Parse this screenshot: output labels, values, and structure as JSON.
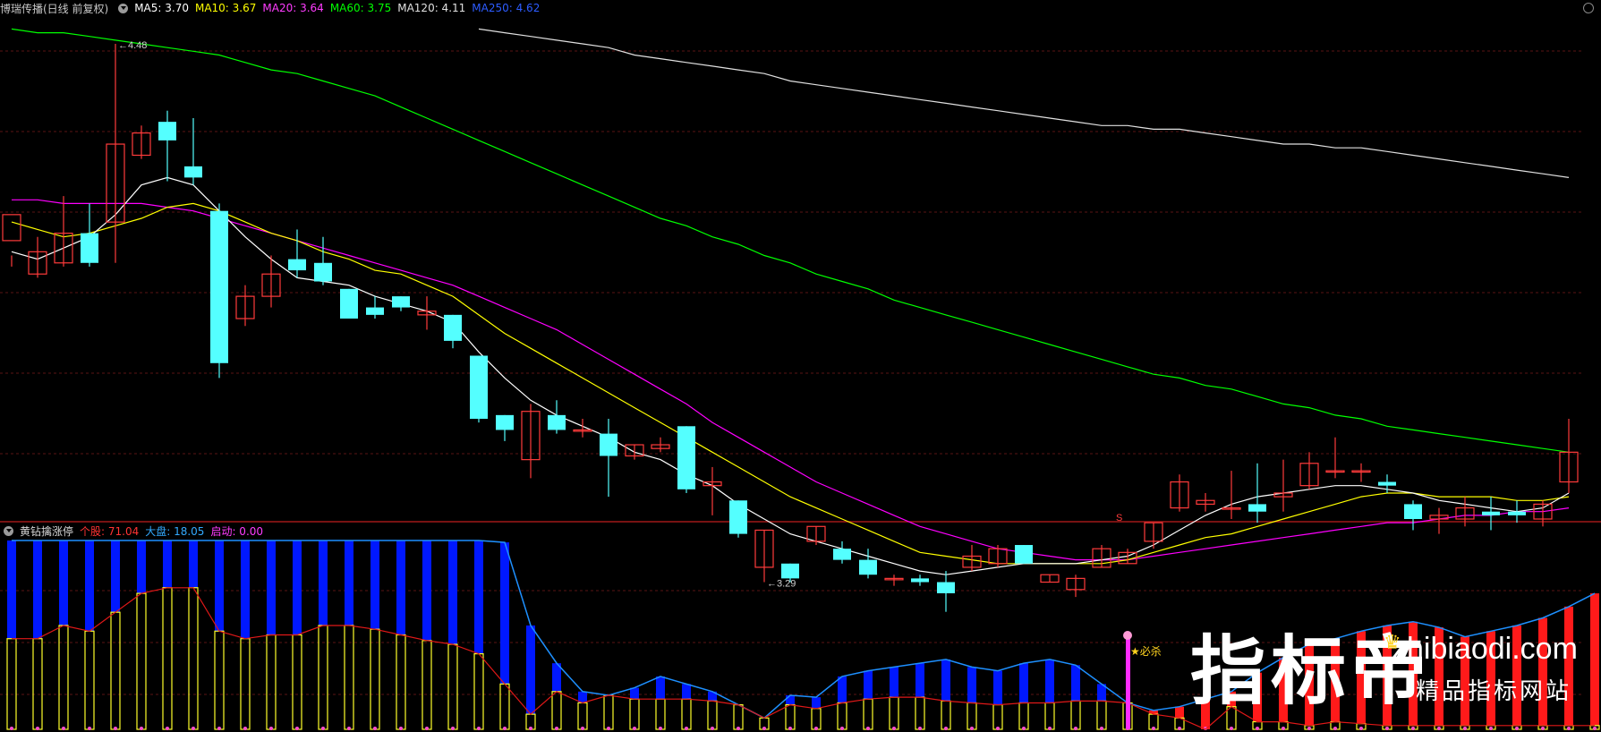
{
  "main_header": {
    "title": "博瑞传播(日线 前复权)",
    "ma5": "MA5: 3.70",
    "ma10": "MA10: 3.67",
    "ma20": "MA20: 3.64",
    "ma60": "MA60: 3.75",
    "ma120": "MA120: 4.11",
    "ma250": "MA250: 4.62"
  },
  "indicator_header": {
    "title": "黄钻擒涨停",
    "stock": "个股: 71.04",
    "market": "大盘: 18.05",
    "start": "启动: 0.00"
  },
  "annotations": {
    "high": "4.48",
    "low": "3.29",
    "s_marker": "S",
    "signal": "★必杀"
  },
  "watermark": {
    "brand": "指标帝",
    "url": "zhibiaodi.com",
    "subtitle": "精品指标网站"
  },
  "colors": {
    "up": "#ff3b3b",
    "down": "#54ffff",
    "ma5": "#ffffff",
    "ma10": "#ffff00",
    "ma20": "#ff00ff",
    "ma60": "#00ff00",
    "ma120": "#e0e0e0",
    "ma250": "#1e5cff",
    "stock_bar": "#0018ff",
    "market_bar": "#ffff2a"
  },
  "chart_data": {
    "type": "candlestick",
    "price_range": [
      3.2,
      4.55
    ],
    "candles": [
      [
        3.95,
        4.02,
        3.91,
        3.88
      ],
      [
        3.86,
        3.92,
        3.96,
        3.85
      ],
      [
        3.89,
        3.97,
        4.07,
        3.88
      ],
      [
        3.97,
        3.89,
        4.05,
        3.88
      ],
      [
        4.0,
        4.21,
        4.48,
        3.89
      ],
      [
        4.18,
        4.24,
        4.26,
        4.17
      ],
      [
        4.27,
        4.22,
        4.3,
        4.11
      ],
      [
        4.15,
        4.12,
        4.28,
        4.1
      ],
      [
        4.03,
        3.62,
        4.05,
        3.58
      ],
      [
        3.74,
        3.8,
        3.83,
        3.72
      ],
      [
        3.8,
        3.86,
        3.91,
        3.77
      ],
      [
        3.9,
        3.87,
        3.98,
        3.85
      ],
      [
        3.89,
        3.84,
        3.96,
        3.83
      ],
      [
        3.82,
        3.74,
        3.82,
        3.74
      ],
      [
        3.77,
        3.75,
        3.8,
        3.74
      ],
      [
        3.8,
        3.77,
        3.8,
        3.76
      ],
      [
        3.75,
        3.76,
        3.8,
        3.71
      ],
      [
        3.75,
        3.68,
        3.75,
        3.66
      ],
      [
        3.64,
        3.47,
        3.64,
        3.46
      ],
      [
        3.48,
        3.44,
        3.48,
        3.41
      ],
      [
        3.36,
        3.49,
        3.51,
        3.31
      ],
      [
        3.48,
        3.44,
        3.52,
        3.43
      ],
      [
        3.44,
        3.44,
        3.47,
        3.42
      ],
      [
        3.43,
        3.37,
        3.47,
        3.26
      ],
      [
        3.37,
        3.4,
        3.4,
        3.36
      ],
      [
        3.39,
        3.4,
        3.42,
        3.38
      ],
      [
        3.45,
        3.28,
        3.45,
        3.27
      ],
      [
        3.29,
        3.3,
        3.34,
        3.21
      ],
      [
        3.25,
        3.16,
        3.25,
        3.15
      ],
      [
        3.07,
        3.17,
        3.17,
        3.03
      ],
      [
        3.08,
        3.04,
        3.08,
        3.03
      ],
      [
        3.14,
        3.18,
        3.18,
        3.13
      ],
      [
        3.12,
        3.09,
        3.14,
        3.08
      ],
      [
        3.09,
        3.05,
        3.12,
        3.04
      ],
      [
        3.04,
        3.04,
        3.05,
        3.02
      ],
      [
        3.04,
        3.03,
        3.05,
        3.02
      ],
      [
        3.03,
        3.0,
        3.06,
        2.95
      ],
      [
        3.07,
        3.1,
        3.13,
        3.06
      ],
      [
        3.08,
        3.12,
        3.13,
        3.07
      ],
      [
        3.13,
        3.08,
        3.13,
        3.08
      ],
      [
        3.03,
        3.05,
        3.05,
        3.03
      ],
      [
        3.01,
        3.04,
        3.05,
        2.99
      ],
      [
        3.07,
        3.12,
        3.13,
        3.07
      ],
      [
        3.08,
        3.11,
        3.12,
        3.08
      ],
      [
        3.14,
        3.19,
        3.19,
        3.12
      ],
      [
        3.23,
        3.3,
        3.32,
        3.22
      ],
      [
        3.24,
        3.25,
        3.27,
        3.22
      ],
      [
        3.23,
        3.23,
        3.33,
        3.2
      ],
      [
        3.24,
        3.22,
        3.35,
        3.19
      ],
      [
        3.26,
        3.27,
        3.36,
        3.22
      ],
      [
        3.29,
        3.35,
        3.38,
        3.28
      ],
      [
        3.33,
        3.33,
        3.42,
        3.31
      ],
      [
        3.33,
        3.33,
        3.35,
        3.3
      ],
      [
        3.3,
        3.29,
        3.32,
        3.27
      ],
      [
        3.24,
        3.2,
        3.25,
        3.17
      ],
      [
        3.2,
        3.21,
        3.23,
        3.16
      ],
      [
        3.2,
        3.23,
        3.26,
        3.18
      ],
      [
        3.22,
        3.21,
        3.26,
        3.17
      ],
      [
        3.22,
        3.21,
        3.25,
        3.19
      ],
      [
        3.2,
        3.24,
        3.25,
        3.18
      ],
      [
        3.3,
        3.38,
        3.47,
        3.27
      ]
    ],
    "ma5": [
      3.92,
      3.9,
      3.93,
      3.96,
      4.02,
      4.1,
      4.12,
      4.1,
      4.03,
      3.96,
      3.9,
      3.85,
      3.84,
      3.83,
      3.8,
      3.78,
      3.76,
      3.73,
      3.65,
      3.58,
      3.52,
      3.48,
      3.45,
      3.42,
      3.38,
      3.36,
      3.32,
      3.29,
      3.24,
      3.2,
      3.16,
      3.14,
      3.12,
      3.1,
      3.08,
      3.06,
      3.05,
      3.06,
      3.07,
      3.08,
      3.08,
      3.08,
      3.09,
      3.1,
      3.13,
      3.17,
      3.21,
      3.24,
      3.26,
      3.27,
      3.28,
      3.29,
      3.29,
      3.28,
      3.27,
      3.25,
      3.24,
      3.23,
      3.22,
      3.23,
      3.27
    ],
    "ma10": [
      4.0,
      3.98,
      3.96,
      3.97,
      3.99,
      4.01,
      4.04,
      4.05,
      4.03,
      4.0,
      3.97,
      3.95,
      3.92,
      3.9,
      3.87,
      3.86,
      3.83,
      3.8,
      3.75,
      3.7,
      3.66,
      3.62,
      3.58,
      3.54,
      3.5,
      3.46,
      3.42,
      3.38,
      3.34,
      3.3,
      3.26,
      3.23,
      3.2,
      3.17,
      3.14,
      3.11,
      3.1,
      3.09,
      3.08,
      3.08,
      3.08,
      3.08,
      3.08,
      3.09,
      3.11,
      3.13,
      3.15,
      3.16,
      3.18,
      3.2,
      3.22,
      3.24,
      3.26,
      3.27,
      3.27,
      3.26,
      3.26,
      3.26,
      3.25,
      3.25,
      3.26
    ],
    "ma20": [
      4.06,
      4.06,
      4.05,
      4.05,
      4.05,
      4.05,
      4.04,
      4.03,
      4.01,
      3.99,
      3.97,
      3.95,
      3.93,
      3.91,
      3.89,
      3.87,
      3.85,
      3.83,
      3.8,
      3.77,
      3.74,
      3.71,
      3.67,
      3.63,
      3.59,
      3.55,
      3.51,
      3.46,
      3.42,
      3.38,
      3.34,
      3.3,
      3.27,
      3.24,
      3.21,
      3.18,
      3.16,
      3.14,
      3.12,
      3.11,
      3.1,
      3.09,
      3.09,
      3.09,
      3.1,
      3.11,
      3.12,
      3.13,
      3.14,
      3.15,
      3.16,
      3.17,
      3.18,
      3.19,
      3.19,
      3.2,
      3.21,
      3.21,
      3.22,
      3.22,
      3.23
    ],
    "ma60": [
      4.52,
      4.51,
      4.51,
      4.5,
      4.49,
      4.48,
      4.47,
      4.46,
      4.45,
      4.43,
      4.41,
      4.4,
      4.38,
      4.36,
      4.34,
      4.31,
      4.28,
      4.25,
      4.22,
      4.19,
      4.16,
      4.13,
      4.1,
      4.07,
      4.04,
      4.01,
      3.99,
      3.96,
      3.94,
      3.91,
      3.89,
      3.86,
      3.84,
      3.82,
      3.79,
      3.77,
      3.75,
      3.73,
      3.71,
      3.69,
      3.67,
      3.65,
      3.63,
      3.61,
      3.59,
      3.58,
      3.56,
      3.55,
      3.53,
      3.51,
      3.5,
      3.48,
      3.47,
      3.45,
      3.44,
      3.43,
      3.42,
      3.41,
      3.4,
      3.39,
      3.38
    ],
    "ma120": [
      null,
      null,
      null,
      null,
      null,
      null,
      null,
      null,
      null,
      null,
      null,
      null,
      null,
      null,
      null,
      null,
      null,
      null,
      4.52,
      4.51,
      4.5,
      4.49,
      4.48,
      4.47,
      4.45,
      4.44,
      4.43,
      4.42,
      4.41,
      4.4,
      4.38,
      4.37,
      4.36,
      4.35,
      4.34,
      4.33,
      4.32,
      4.31,
      4.3,
      4.29,
      4.28,
      4.27,
      4.26,
      4.26,
      4.25,
      4.25,
      4.24,
      4.23,
      4.22,
      4.21,
      4.21,
      4.2,
      4.2,
      4.19,
      4.18,
      4.17,
      4.16,
      4.15,
      4.14,
      4.13,
      4.12
    ],
    "indicator_range": [
      0,
      100
    ],
    "stock_values": [
      100,
      100,
      100,
      100,
      100,
      100,
      100,
      100,
      100,
      100,
      100,
      100,
      100,
      100,
      100,
      100,
      100,
      100,
      100,
      99,
      55,
      35,
      20,
      18,
      22,
      28,
      24,
      20,
      13,
      6,
      18,
      17,
      28,
      31,
      33,
      35,
      37,
      33,
      31,
      35,
      37,
      34,
      24,
      14,
      10,
      12,
      16,
      20,
      30,
      38,
      45,
      48,
      52,
      55,
      57,
      54,
      49,
      52,
      55,
      59,
      65,
      72
    ],
    "market_values": [
      48,
      48,
      55,
      52,
      62,
      72,
      75,
      75,
      52,
      48,
      50,
      50,
      55,
      55,
      53,
      50,
      47,
      45,
      40,
      24,
      8,
      20,
      14,
      18,
      16,
      16,
      16,
      15,
      13,
      6,
      13,
      11,
      14,
      16,
      17,
      17,
      15,
      14,
      13,
      14,
      14,
      15,
      15,
      14,
      8,
      6,
      0,
      12,
      4,
      4,
      2,
      4,
      3,
      2,
      2,
      2,
      2,
      2,
      2,
      2,
      2,
      2
    ]
  }
}
